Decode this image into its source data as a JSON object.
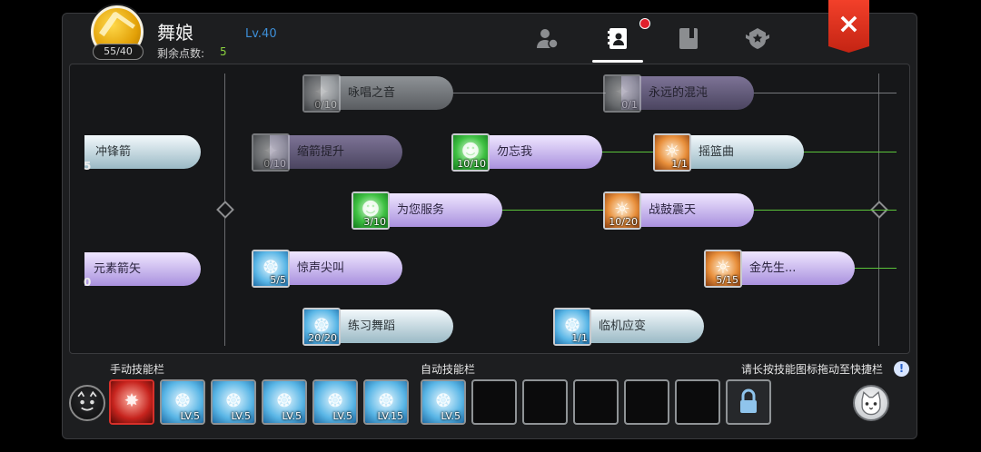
{
  "header": {
    "name": "舞娘",
    "level": "Lv.40",
    "points_badge": "55/40",
    "remain_label": "剩余点数:",
    "remain_value": "5",
    "tabs": [
      "profile-tab",
      "skills-tab",
      "book-tab",
      "emblem-tab"
    ],
    "active_tab": "skills-tab",
    "close_label": "×"
  },
  "tree": {
    "left_partial": [
      {
        "label": "冲锋箭",
        "count": "5"
      },
      {
        "label": "元素箭矢",
        "count": "0"
      }
    ],
    "nodes": [
      {
        "id": "chant",
        "label": "咏唱之音",
        "count": "0/10",
        "style": "gray",
        "icon": "gray",
        "dim": true
      },
      {
        "id": "eternal-chaos",
        "label": "永远的混沌",
        "count": "0/1",
        "style": "dpurple",
        "icon": "gray",
        "dim": true
      },
      {
        "id": "improve-concentration",
        "label": "缩箭提升",
        "count": "0/10",
        "style": "dpurple",
        "icon": "gray",
        "dim": true
      },
      {
        "id": "forget-me-not",
        "label": "勿忘我",
        "count": "10/10",
        "style": "purple",
        "icon": "green"
      },
      {
        "id": "lullaby",
        "label": "摇篮曲",
        "count": "1/1",
        "style": "blue",
        "icon": "orange"
      },
      {
        "id": "service-for-you",
        "label": "为您服务",
        "count": "3/10",
        "style": "purple",
        "icon": "green"
      },
      {
        "id": "war-drum",
        "label": "战鼓震天",
        "count": "10/20",
        "style": "purple",
        "icon": "orange"
      },
      {
        "id": "frightening-scream",
        "label": "惊声尖叫",
        "count": "5/5",
        "style": "purple",
        "icon": "blue"
      },
      {
        "id": "mr-gold",
        "label": "金先生...",
        "count": "5/15",
        "style": "purple",
        "icon": "orange"
      },
      {
        "id": "dance-lesson",
        "label": "练习舞蹈",
        "count": "20/20",
        "style": "blue",
        "icon": "blue"
      },
      {
        "id": "improvisation",
        "label": "临机应变",
        "count": "1/1",
        "style": "blue",
        "icon": "blue"
      }
    ]
  },
  "bottom": {
    "manual_label": "手动技能栏",
    "auto_label": "自动技能栏",
    "hint": "请长按技能图标拖动至快捷栏",
    "hint_icon": "!",
    "manual_slots": [
      {
        "icon": "red",
        "lv": ""
      },
      {
        "icon": "blue",
        "lv": "LV.5"
      },
      {
        "icon": "blue",
        "lv": "LV.5"
      },
      {
        "icon": "blue",
        "lv": "LV.5"
      },
      {
        "icon": "blue",
        "lv": "LV.5"
      },
      {
        "icon": "blue",
        "lv": "LV.15"
      }
    ],
    "auto_slots": [
      {
        "icon": "blue",
        "lv": "LV.5"
      },
      {
        "icon": "",
        "lv": ""
      },
      {
        "icon": "",
        "lv": ""
      },
      {
        "icon": "",
        "lv": ""
      },
      {
        "icon": "",
        "lv": ""
      },
      {
        "icon": "",
        "lv": ""
      }
    ]
  }
}
